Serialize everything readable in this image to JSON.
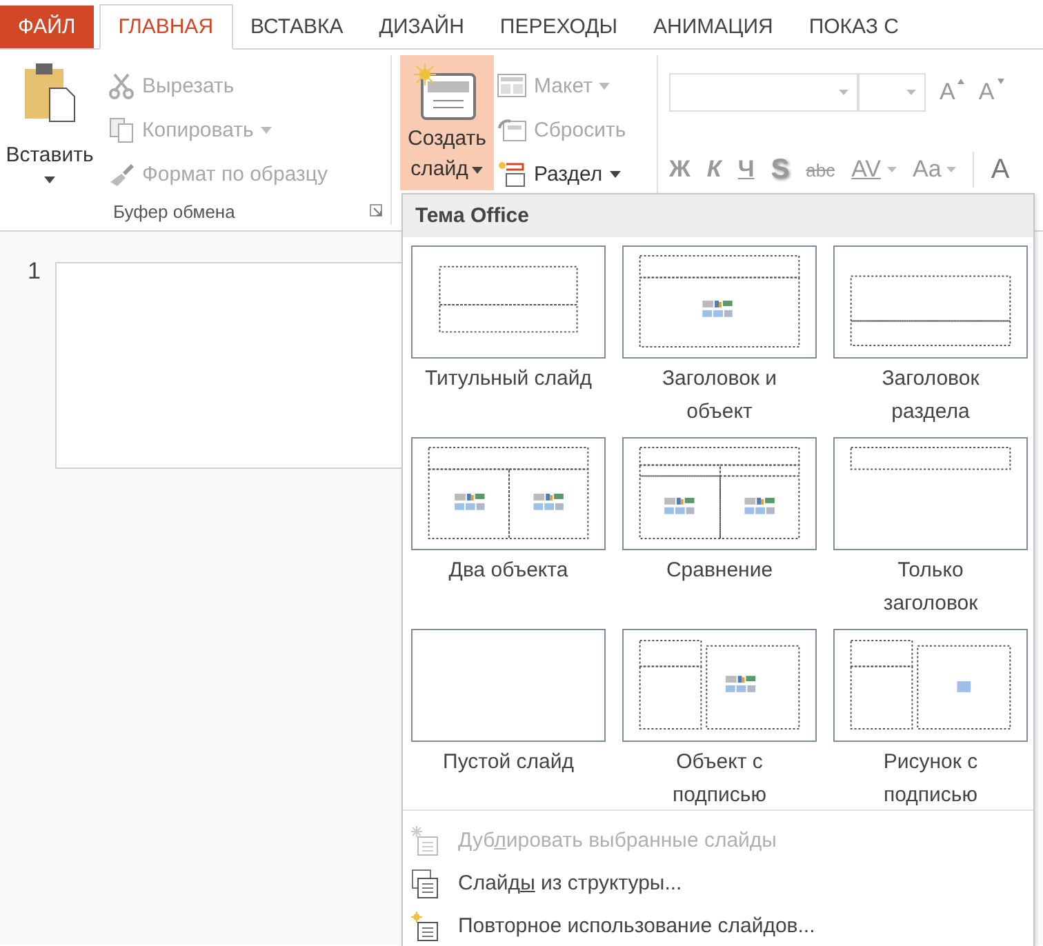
{
  "tabs": [
    {
      "label": "ФАЙЛ",
      "kind": "file",
      "selected": false
    },
    {
      "label": "ГЛАВНАЯ",
      "kind": "tab",
      "selected": true
    },
    {
      "label": "ВСТАВКА",
      "kind": "tab",
      "selected": false
    },
    {
      "label": "ДИЗАЙН",
      "kind": "tab",
      "selected": false
    },
    {
      "label": "ПЕРЕХОДЫ",
      "kind": "tab",
      "selected": false
    },
    {
      "label": "АНИМАЦИЯ",
      "kind": "tab",
      "selected": false
    },
    {
      "label": "ПОКАЗ С",
      "kind": "tab",
      "selected": false
    }
  ],
  "clipboard": {
    "paste": {
      "label": "Вставить"
    },
    "actions": [
      {
        "label": "Вырезать",
        "disabled": true,
        "dropdown": false
      },
      {
        "label": "Копировать",
        "disabled": true,
        "dropdown": true
      },
      {
        "label": "Формат по образцу",
        "disabled": true,
        "dropdown": false
      }
    ],
    "group_label": "Буфер обмена"
  },
  "slides": {
    "new_slide": {
      "label": "Создать\nслайд",
      "highlighted": true
    },
    "actions": [
      {
        "label": "Макет",
        "disabled": true,
        "dropdown": true
      },
      {
        "label": "Сбросить",
        "disabled": true,
        "dropdown": false
      },
      {
        "label": "Раздел",
        "disabled": false,
        "dropdown": true
      }
    ]
  },
  "font": {
    "size_buttons": [
      {
        "label": "A",
        "kind": "grow"
      },
      {
        "label": "A",
        "kind": "shrink"
      }
    ],
    "format_buttons": [
      {
        "label": "Ж",
        "kind": "bold",
        "dropdown": false
      },
      {
        "label": "К",
        "kind": "italic",
        "dropdown": false
      },
      {
        "label": "Ч",
        "kind": "underline",
        "dropdown": false
      },
      {
        "label": "S",
        "kind": "shadow",
        "dropdown": false
      },
      {
        "label": "abc",
        "kind": "strike",
        "dropdown": false
      },
      {
        "label": "AV",
        "kind": "spacing",
        "dropdown": true
      },
      {
        "label": "Aa",
        "kind": "case",
        "dropdown": true
      }
    ],
    "cut_button": {
      "label": "A"
    }
  },
  "slide_pane": {
    "number": "1"
  },
  "menu": {
    "title": "Тема Office",
    "layouts": [
      {
        "label": "Титульный слайд",
        "kind": "title"
      },
      {
        "label": "Заголовок и\nобъект",
        "kind": "title_content"
      },
      {
        "label": "Заголовок\nраздела",
        "kind": "section"
      },
      {
        "label": "Два объекта",
        "kind": "two_content"
      },
      {
        "label": "Сравнение",
        "kind": "comparison"
      },
      {
        "label": "Только\nзаголовок",
        "kind": "title_only"
      },
      {
        "label": "Пустой слайд",
        "kind": "blank"
      },
      {
        "label": "Объект с\nподписью",
        "kind": "content_caption"
      },
      {
        "label": "Рисунок с\nподписью",
        "kind": "picture_caption"
      }
    ],
    "items": [
      {
        "before": "Дуб",
        "key": "л",
        "after": "ировать выбранные слайды",
        "disabled": true
      },
      {
        "before": "Слайд",
        "key": "ы",
        "after": " из структуры...",
        "disabled": false
      },
      {
        "before": "Повторное использование слайдов...",
        "disabled": false
      }
    ]
  }
}
